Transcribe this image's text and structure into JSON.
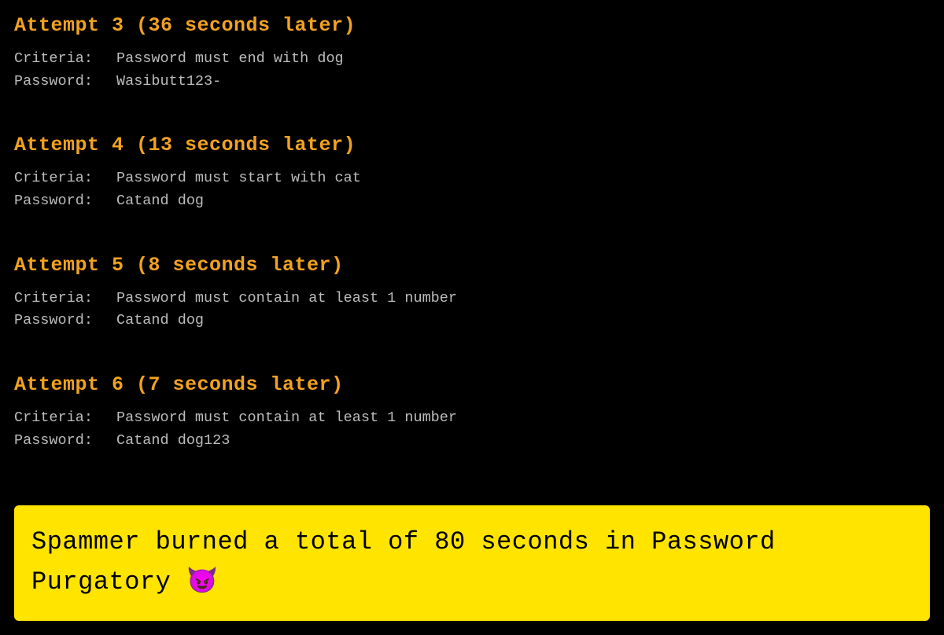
{
  "labels": {
    "criteria": "Criteria:",
    "password": "Password:"
  },
  "attempts": [
    {
      "title": "Attempt 3 (36 seconds later)",
      "criteria": "Password must end with dog",
      "password": "Wasibutt123-"
    },
    {
      "title": "Attempt 4 (13 seconds later)",
      "criteria": "Password must start with cat",
      "password": "Catand dog"
    },
    {
      "title": "Attempt 5 (8 seconds later)",
      "criteria": "Password must contain at least 1 number",
      "password": "Catand dog"
    },
    {
      "title": "Attempt 6 (7 seconds later)",
      "criteria": "Password must contain at least 1 number",
      "password": "Catand dog123"
    }
  ],
  "summary": {
    "text": "Spammer burned a total of 80 seconds in Password Purgatory ",
    "emoji": "😈"
  }
}
